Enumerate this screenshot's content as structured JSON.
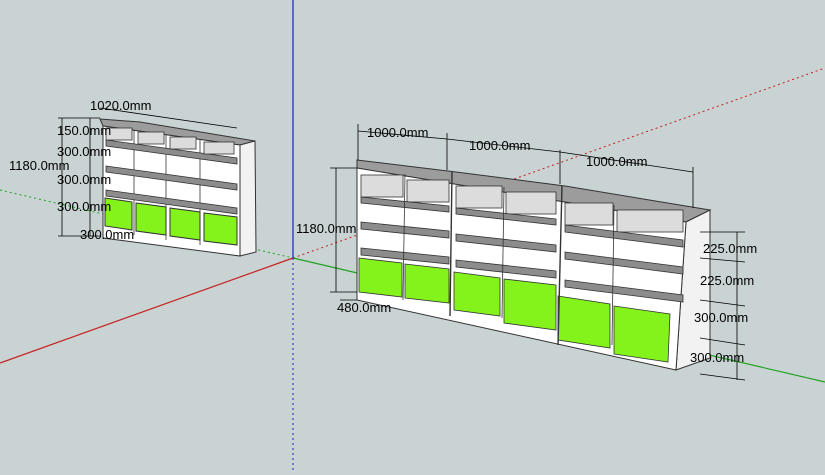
{
  "colors": {
    "background": "#c9d3d3",
    "front_panel": "#84f21b",
    "cabinet_face": "#ffffff",
    "cabinet_side": "#f2f2f2",
    "cabinet_top": "#9c9c9c",
    "shelf": "#8c8c8c",
    "interior": "#dcdcdc",
    "axis_red": "#c81e1e",
    "axis_green": "#1fa31f",
    "axis_blue": "#1e1ec8"
  },
  "small_model": {
    "width_label": "1020.0mm",
    "row_labels": [
      "150.0mm",
      "300.0mm",
      "300.0mm",
      "300.0mm"
    ],
    "height_label": "1180.0mm",
    "bottom_label": "300.0mm"
  },
  "large_model": {
    "unit_width_labels": [
      "1000.0mm",
      "1000.0mm",
      "1000.0mm"
    ],
    "height_label": "1180.0mm",
    "depth_label": "480.0mm",
    "side_labels": [
      "225.0mm",
      "225.0mm",
      "300.0mm",
      "300.0mm"
    ]
  }
}
